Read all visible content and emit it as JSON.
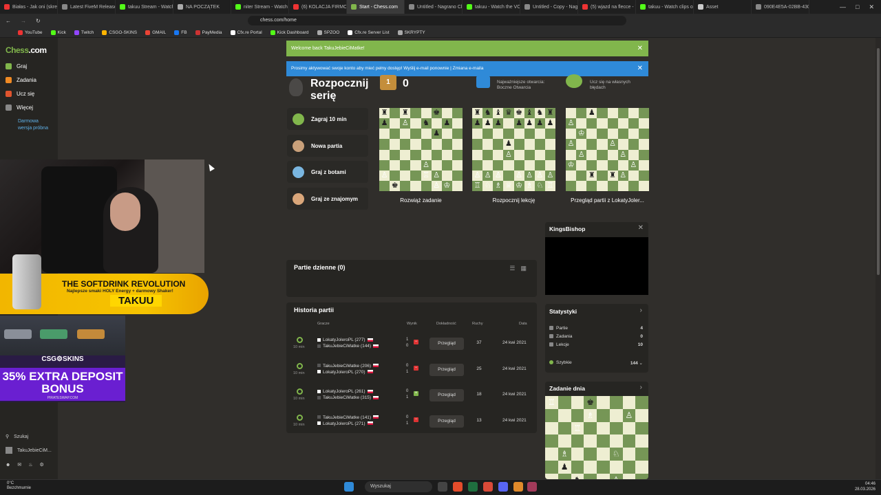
{
  "browser": {
    "tabs": [
      {
        "label": "Białas - Jak oni (skrec",
        "color": "#e33"
      },
      {
        "label": "Latest FiveM Releases",
        "color": "#888"
      },
      {
        "label": "takuu Stream - Watch",
        "color": "#53fc18"
      },
      {
        "label": "NA POCZĄTEK",
        "color": "#aaa"
      },
      {
        "label": "niter Stream - Watch",
        "color": "#53fc18"
      },
      {
        "label": "(6) KOLACJA FIRMOW",
        "color": "#e33"
      },
      {
        "label": "Start - Chess.com",
        "color": "#81b64c",
        "active": true
      },
      {
        "label": "Untitled - Nagrano Cl",
        "color": "#888"
      },
      {
        "label": "takuu - Watch the VO",
        "color": "#53fc18"
      },
      {
        "label": "Untitled - Copy - Nag",
        "color": "#888"
      },
      {
        "label": "(5) wjazd na flecce - Y",
        "color": "#e33"
      },
      {
        "label": "takuu - Watch clips o",
        "color": "#53fc18"
      },
      {
        "label": "Asset",
        "color": "#ccc"
      },
      {
        "label": "090E4E5A-02BB-430",
        "color": "#888"
      }
    ],
    "url": "chess.com/home",
    "bookmarks": [
      "YouTube",
      "Kick",
      "Twitch",
      "CSGO-SKINS",
      "GMAIL",
      "FB",
      "PayMedia",
      "Cfx.re Portal",
      "Kick Dashboard",
      "SPZOO",
      "Cfx.re Server List",
      "SKRYPTY"
    ]
  },
  "sidebar": {
    "logo_main": "Chess",
    "logo_suffix": ".com",
    "items": [
      {
        "label": "Graj",
        "color": "#81b64c"
      },
      {
        "label": "Zadania",
        "color": "#f08a24"
      },
      {
        "label": "Ucz się",
        "color": "#e0542e"
      },
      {
        "label": "Więcej",
        "color": "#888"
      }
    ],
    "trial": "Darmowa wersja próbna",
    "search": "Szukaj",
    "username": "TakuJebieCiM..."
  },
  "overlay": {
    "sponsor1_headline": "THE SOFTDRINK REVOLUTION",
    "sponsor1_sub": "Najlepsze smaki HOLY Energy + darmowy Shaker!",
    "sponsor1_code": "TAKUU",
    "sponsor2_brand": "CSG⚙SKINS",
    "sponsor2_offer": "35% EXTRA DEPOSIT BONUS",
    "sponsor2_site": "PIRATESWAP.COM"
  },
  "banners": {
    "welcome": "Welcome back TakuJebieCiMatke!",
    "email": "Prosimy aktywować swoje konto aby mieć pełny dostęp! Wyślij e-mail ponownie | Zmiana e-maila"
  },
  "streak": {
    "title": "Rozpocznij serię",
    "count": "0",
    "medal": "1",
    "openings_hint": "Najważniejsze otwarcia: Boczne Otwarcia",
    "mistakes_hint": "Ucz się na własnych błędach"
  },
  "play_buttons": [
    {
      "label": "Zagraj 10 min",
      "color": "#81b64c"
    },
    {
      "label": "Nowa partia",
      "color": "#c9a07a"
    },
    {
      "label": "Graj z botami",
      "color": "#7ab6e0"
    },
    {
      "label": "Graj ze znajomym",
      "color": "#d9a67a"
    }
  ],
  "cards": [
    {
      "caption": "Rozwiąż zadanie"
    },
    {
      "caption": "Rozpocznij lekcję"
    },
    {
      "caption": "Przegląd partii z LokatyJoler..."
    }
  ],
  "daily": {
    "title": "Partie dzienne",
    "count": "(0)"
  },
  "history": {
    "title": "Historia partii",
    "headers": {
      "players": "Gracze",
      "result": "Wynik",
      "accuracy": "Dokładność",
      "moves": "Ruchy",
      "date": "Data"
    },
    "review_label": "Przegląd",
    "rows": [
      {
        "tc": "10 min",
        "p1": "LokatyJoleroPL (277)",
        "p2": "TakuJebieCiMatke (144)",
        "r1": "1",
        "r2": "0",
        "outcome": "loss",
        "moves": "37",
        "date": "24 kwi 2021"
      },
      {
        "tc": "10 min",
        "p1": "TakuJebieCiMatke (206)",
        "p2": "LokatyJoleroPL (270)",
        "r1": "0",
        "r2": "1",
        "outcome": "loss",
        "moves": "25",
        "date": "24 kwi 2021"
      },
      {
        "tc": "10 min",
        "p1": "LokatyJoleroPL (261)",
        "p2": "TakuJebieCiMatke (315)",
        "r1": "0",
        "r2": "1",
        "outcome": "win",
        "moves": "18",
        "date": "24 kwi 2021"
      },
      {
        "tc": "10 min",
        "p1": "TakuJebieCiMatke (141)",
        "p2": "LokatyJoleroPL (271)",
        "r1": "0",
        "r2": "1",
        "outcome": "loss",
        "moves": "13",
        "date": "24 kwi 2021"
      }
    ]
  },
  "kingsbishop": {
    "title": "KingsBishop"
  },
  "stats": {
    "title": "Statystyki",
    "rows": [
      {
        "label": "Partie",
        "value": "4"
      },
      {
        "label": "Zadania",
        "value": "0"
      },
      {
        "label": "Lekcje",
        "value": "10"
      }
    ],
    "rapid_label": "Szybkie",
    "rapid_value": "144"
  },
  "puzzle": {
    "title": "Zadanie dnia"
  },
  "taskbar": {
    "weather_temp": "0°C",
    "weather_desc": "Bezchmurnie",
    "search": "Wyszukaj",
    "time": "04:46",
    "date": "28.03.2026"
  },
  "colors": {
    "chess_green": "#81b64c",
    "board_light": "#eeeed2",
    "board_dark": "#769656",
    "banner_blue": "#2f8ad8"
  }
}
